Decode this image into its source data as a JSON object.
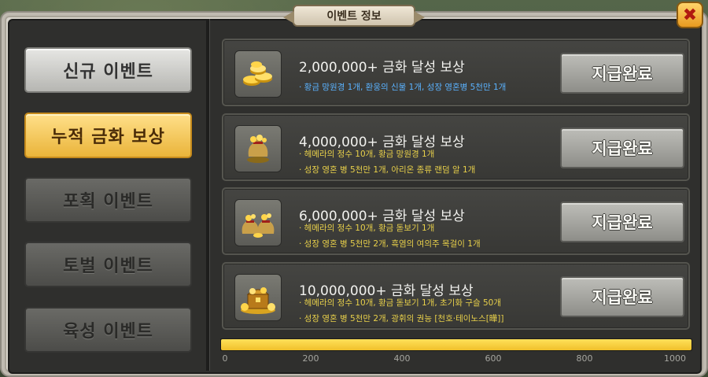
{
  "window": {
    "title": "이벤트 정보",
    "close_icon": "close-icon"
  },
  "sidebar": {
    "tabs": [
      {
        "label": "신규 이벤트",
        "state": "normal"
      },
      {
        "label": "누적 금화 보상",
        "state": "selected"
      },
      {
        "label": "포획 이벤트",
        "state": "disabled"
      },
      {
        "label": "토벌 이벤트",
        "state": "disabled"
      },
      {
        "label": "육성 이벤트",
        "state": "disabled"
      }
    ]
  },
  "rewards": [
    {
      "icon": "gold-coins-icon",
      "title": "2,000,000+ 금화 달성 보상",
      "lines": [
        {
          "text": "· 황금 망원경 1개, 환웅의 신물 1개, 성장 영혼병 5천만 1개",
          "color": "blue"
        }
      ],
      "button": "지급완료"
    },
    {
      "icon": "small-gold-sack-icon",
      "title": "4,000,000+ 금화 달성 보상",
      "lines": [
        {
          "text": "· 헤메라의 정수 10개, 황금 망원경 1개",
          "color": "yellow"
        },
        {
          "text": "· 성장 영혼 병 5천만 1개, 아리온 종류 랜덤 알 1개",
          "color": "yellow"
        }
      ],
      "button": "지급완료"
    },
    {
      "icon": "gold-sacks-icon",
      "title": "6,000,000+ 금화 달성 보상",
      "lines": [
        {
          "text": "· 헤메라의 정수 10개, 황금 돋보기 1개",
          "color": "yellow"
        },
        {
          "text": "· 성장 영혼 병 5천만 2개, 흑염의 여의주 목걸이 1개",
          "color": "yellow"
        }
      ],
      "button": "지급완료"
    },
    {
      "icon": "treasure-chest-icon",
      "title": "10,000,000+ 금화 달성 보상",
      "lines": [
        {
          "text": "· 헤메라의 정수 10개, 황금 돋보기 1개, 초기화 구슬 50개",
          "color": "yellow"
        },
        {
          "text": "· 성장 영혼 병 5천만 2개, 광휘의 권능 [천호·테이노스[曄]]",
          "color": "yellow"
        }
      ],
      "button": "지급완료"
    }
  ],
  "progress": {
    "value": 1000,
    "max": 1000,
    "fill_color": "#f0c02a",
    "ticks": [
      "0",
      "200",
      "400",
      "600",
      "800",
      "1000"
    ]
  }
}
